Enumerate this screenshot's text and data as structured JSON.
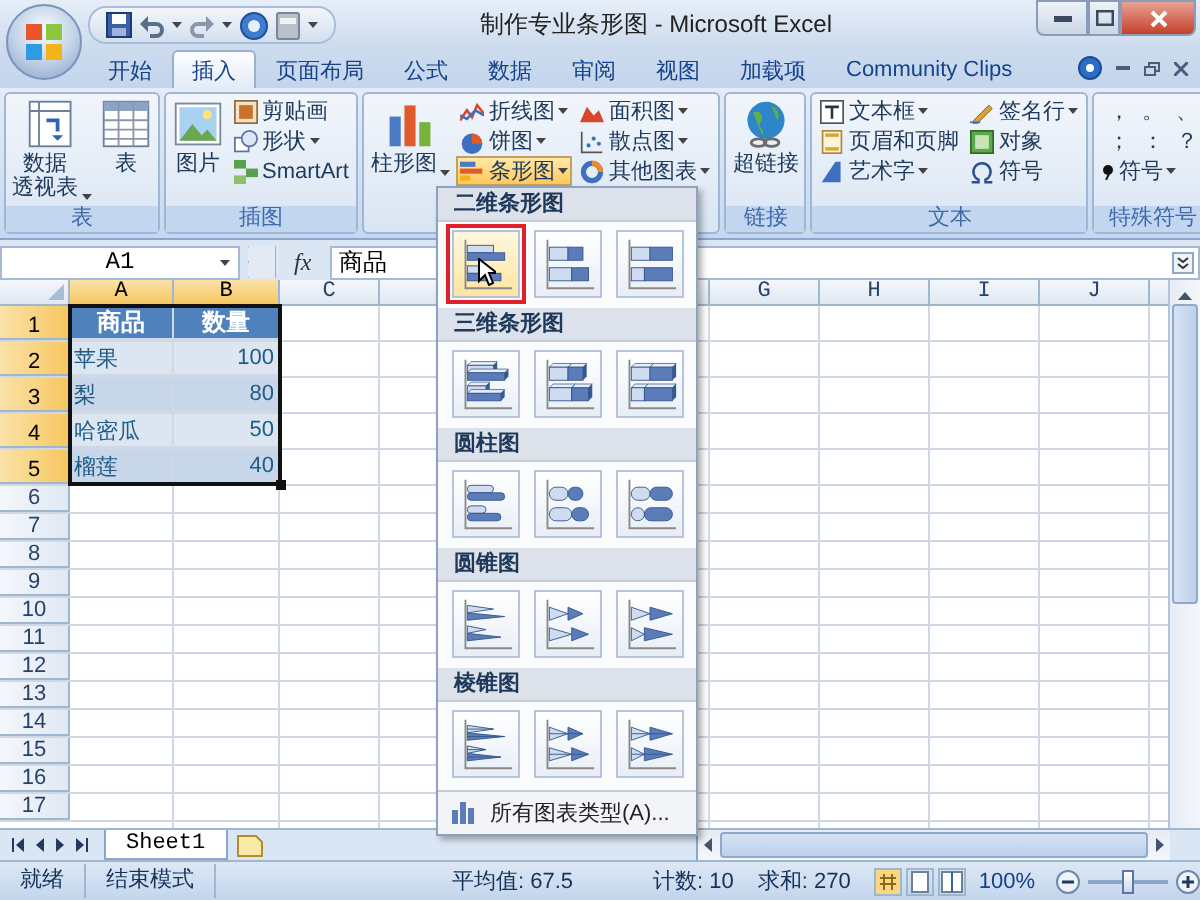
{
  "window": {
    "title": "制作专业条形图 - Microsoft Excel"
  },
  "tabs": [
    {
      "label": "开始",
      "selected": false
    },
    {
      "label": "插入",
      "selected": true
    },
    {
      "label": "页面布局",
      "selected": false
    },
    {
      "label": "公式",
      "selected": false
    },
    {
      "label": "数据",
      "selected": false
    },
    {
      "label": "审阅",
      "selected": false
    },
    {
      "label": "视图",
      "selected": false
    },
    {
      "label": "加载项",
      "selected": false
    },
    {
      "label": "Community Clips",
      "selected": false
    }
  ],
  "ribbon": {
    "groups": [
      {
        "label": "表",
        "items": [
          {
            "kind": "large",
            "lines": [
              "数据",
              "透视表"
            ],
            "dropdown": true
          },
          {
            "kind": "large",
            "label": "表",
            "dropdown": false
          }
        ]
      },
      {
        "label": "插图",
        "items": [
          {
            "kind": "large",
            "label": "图片",
            "dropdown": false
          },
          {
            "kind": "column",
            "items": [
              {
                "label": "剪贴画",
                "dropdown": false,
                "expanded": false
              },
              {
                "label": "形状",
                "dropdown": true,
                "expanded": false
              },
              {
                "label": "SmartArt",
                "dropdown": false,
                "expanded": false
              }
            ]
          }
        ]
      },
      {
        "items": [
          {
            "kind": "large",
            "label": "柱形图",
            "dropdown": true
          },
          {
            "kind": "column",
            "items": [
              {
                "label": "折线图",
                "dropdown": true,
                "expanded": false
              },
              {
                "label": "饼图",
                "dropdown": true,
                "expanded": false
              },
              {
                "label": "条形图",
                "dropdown": true,
                "expanded": true
              }
            ]
          },
          {
            "kind": "column",
            "items": [
              {
                "label": "面积图",
                "dropdown": true,
                "expanded": false
              },
              {
                "label": "散点图",
                "dropdown": true,
                "expanded": false
              },
              {
                "label": "其他图表",
                "dropdown": true,
                "expanded": false
              }
            ]
          }
        ]
      },
      {
        "label": "链接",
        "items": [
          {
            "kind": "large",
            "label": "超链接",
            "dropdown": false
          }
        ]
      },
      {
        "label": "文本",
        "items": [
          {
            "kind": "column",
            "items": [
              {
                "label": "文本框",
                "dropdown": true,
                "expanded": false
              },
              {
                "label": "页眉和页脚",
                "dropdown": false,
                "expanded": false
              },
              {
                "label": "艺术字",
                "dropdown": true,
                "expanded": false
              }
            ]
          },
          {
            "kind": "column",
            "items": [
              {
                "label": "签名行",
                "dropdown": true,
                "expanded": false
              },
              {
                "label": "对象",
                "dropdown": false,
                "expanded": false
              },
              {
                "label": "符号",
                "dropdown": false,
                "expanded": false
              }
            ]
          }
        ]
      },
      {
        "label": "特殊符号",
        "items": [
          {
            "kind": "symbols",
            "chars": [
              "，",
              "。",
              "、",
              "；",
              "：",
              "？"
            ],
            "button": {
              "label": "符号",
              "dropdown": true
            }
          }
        ]
      }
    ]
  },
  "formula_bar": {
    "name_box": "A1",
    "function_label": "fx",
    "content": "商品"
  },
  "sheet": {
    "columns": [
      {
        "label": "A",
        "selected": true
      },
      {
        "label": "B",
        "selected": true
      },
      {
        "label": "C",
        "selected": false
      },
      {
        "label": "G",
        "selected": false,
        "gap_before": true
      },
      {
        "label": "H",
        "selected": false
      },
      {
        "label": "I",
        "selected": false
      },
      {
        "label": "J",
        "selected": false
      }
    ],
    "rows": [
      {
        "label": "1",
        "selected": true
      },
      {
        "label": "2",
        "selected": true
      },
      {
        "label": "3",
        "selected": true
      },
      {
        "label": "4",
        "selected": true
      },
      {
        "label": "5",
        "selected": true
      },
      {
        "label": "6",
        "selected": false
      },
      {
        "label": "7",
        "selected": false
      },
      {
        "label": "8",
        "selected": false
      },
      {
        "label": "9",
        "selected": false
      },
      {
        "label": "10",
        "selected": false
      },
      {
        "label": "11",
        "selected": false
      },
      {
        "label": "12",
        "selected": false
      },
      {
        "label": "13",
        "selected": false
      },
      {
        "label": "14",
        "selected": false
      },
      {
        "label": "15",
        "selected": false
      },
      {
        "label": "16",
        "selected": false
      },
      {
        "label": "17",
        "selected": false
      }
    ],
    "table": {
      "header": [
        "商品",
        "数量"
      ],
      "rows": [
        [
          "苹果",
          "100"
        ],
        [
          "梨",
          "80"
        ],
        [
          "哈密瓜",
          "50"
        ],
        [
          "榴莲",
          "40"
        ]
      ]
    }
  },
  "sheet_tabs": [
    {
      "label": "Sheet1",
      "selected": true
    }
  ],
  "gallery": {
    "sections": [
      {
        "title": "二维条形图",
        "kind": "bar2d",
        "items": [
          {
            "selected": true
          },
          {
            "selected": false
          },
          {
            "selected": false
          }
        ]
      },
      {
        "title": "三维条形图",
        "kind": "bar3d",
        "items": [
          {
            "selected": false
          },
          {
            "selected": false
          },
          {
            "selected": false
          }
        ]
      },
      {
        "title": "圆柱图",
        "kind": "cylinder",
        "items": [
          {
            "selected": false
          },
          {
            "selected": false
          },
          {
            "selected": false
          }
        ]
      },
      {
        "title": "圆锥图",
        "kind": "cone",
        "items": [
          {
            "selected": false
          },
          {
            "selected": false
          },
          {
            "selected": false
          }
        ]
      },
      {
        "title": "棱锥图",
        "kind": "pyramid",
        "items": [
          {
            "selected": false
          },
          {
            "selected": false
          },
          {
            "selected": false
          }
        ]
      }
    ],
    "footer": "所有图表类型(A)..."
  },
  "status_bar": {
    "items": [
      "就绪",
      "结束模式"
    ],
    "stats": [
      "平均值: 67.5",
      "计数: 10",
      "求和: 270"
    ],
    "zoom": {
      "label": "100%",
      "level": 0.5
    }
  }
}
